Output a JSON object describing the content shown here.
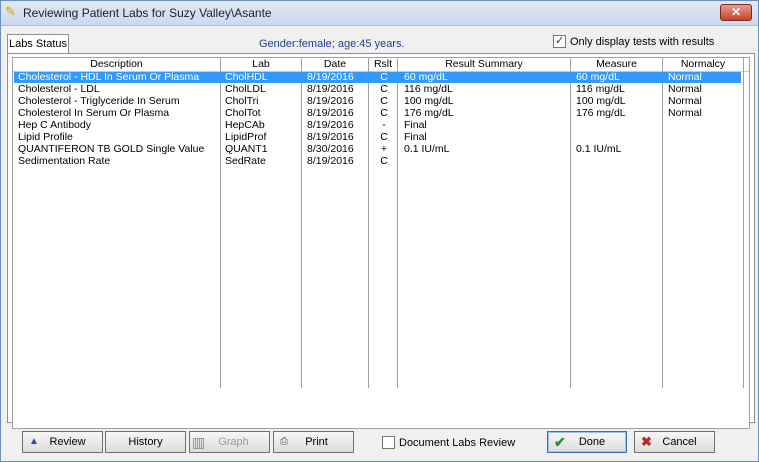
{
  "window": {
    "title": "Reviewing Patient Labs for Suzy Valley\\Asante",
    "close_label": "✕"
  },
  "tabs": [
    {
      "label": "Labs Status"
    }
  ],
  "patient_info": "Gender:female; age:45 years.",
  "filter": {
    "label": "Only display tests with results",
    "checked": true
  },
  "columns": [
    "Description",
    "Lab",
    "Date",
    "Rslt",
    "Result Summary",
    "Measure",
    "Normalcy"
  ],
  "rows": [
    {
      "description": "Cholesterol - HDL In Serum Or Plasma",
      "lab": "CholHDL",
      "date": "8/19/2016",
      "rslt": "C",
      "summary": "60 mg/dL",
      "measure": "60 mg/dL",
      "normalcy": "Normal",
      "selected": true
    },
    {
      "description": "Cholesterol - LDL",
      "lab": "CholLDL",
      "date": "8/19/2016",
      "rslt": "C",
      "summary": "116 mg/dL",
      "measure": "116 mg/dL",
      "normalcy": "Normal"
    },
    {
      "description": "Cholesterol - Triglyceride In Serum",
      "lab": "CholTri",
      "date": "8/19/2016",
      "rslt": "C",
      "summary": "100 mg/dL",
      "measure": "100 mg/dL",
      "normalcy": "Normal"
    },
    {
      "description": "Cholesterol In Serum Or Plasma",
      "lab": "CholTot",
      "date": "8/19/2016",
      "rslt": "C",
      "summary": "176 mg/dL",
      "measure": "176 mg/dL",
      "normalcy": "Normal"
    },
    {
      "description": "Hep C Antibody",
      "lab": "HepCAb",
      "date": "8/19/2016",
      "rslt": "-",
      "summary": "Final",
      "measure": "",
      "normalcy": ""
    },
    {
      "description": "Lipid Profile",
      "lab": "LipidProf",
      "date": "8/19/2016",
      "rslt": "C",
      "summary": "Final",
      "measure": "",
      "normalcy": ""
    },
    {
      "description": "QUANTIFERON TB GOLD Single Value",
      "lab": "QUANT1",
      "date": "8/30/2016",
      "rslt": "+",
      "summary": "0.1  IU/mL",
      "measure": "0.1 IU/mL",
      "normalcy": ""
    },
    {
      "description": "Sedimentation Rate",
      "lab": "SedRate",
      "date": "8/19/2016",
      "rslt": "C",
      "summary": "",
      "measure": "",
      "normalcy": ""
    }
  ],
  "nav": {
    "first": "I◀",
    "prev_page": "◀◀",
    "prev": "◀",
    "help": "?",
    "next": "▶",
    "next_page": "▶▶",
    "last": "▶I"
  },
  "buttons": {
    "review": "Review",
    "history": "History",
    "graph": "Graph",
    "print": "Print",
    "done": "Done",
    "cancel": "Cancel"
  },
  "document_review": {
    "label": "Document Labs Review",
    "checked": false
  },
  "colors": {
    "selection": "#3399ff",
    "patient_info": "#1f3f8f"
  },
  "icons": {
    "review": "triangle-icon",
    "graph": "graph-icon",
    "print": "printer-icon",
    "done": "checkmark-icon",
    "cancel": "x-icon"
  }
}
